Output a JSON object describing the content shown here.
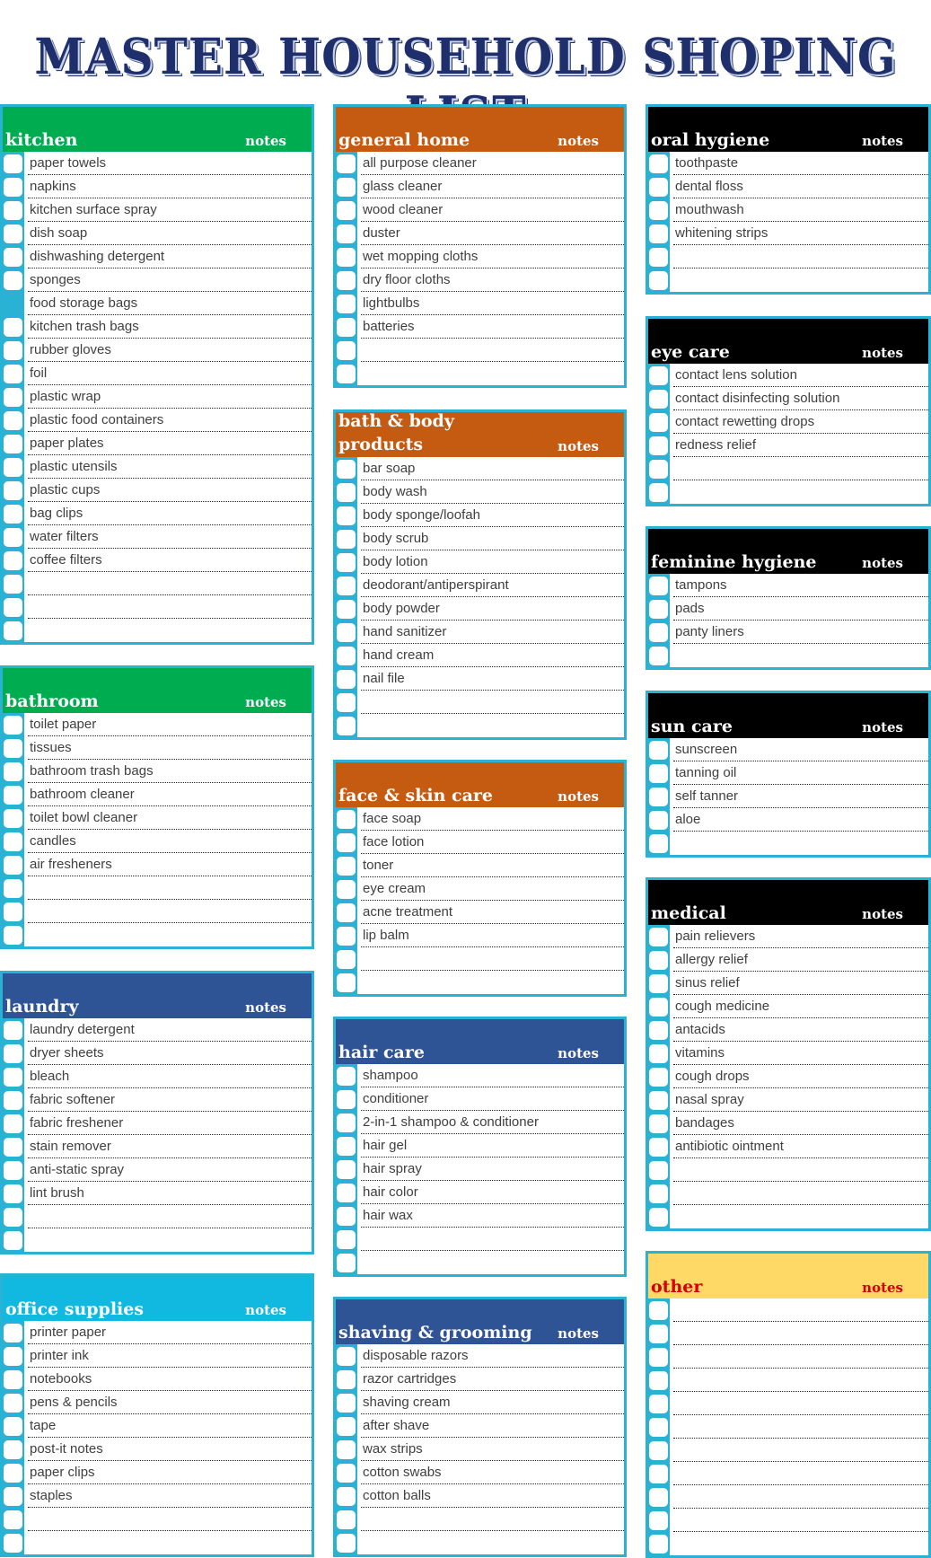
{
  "title": "MASTER HOUSEHOLD SHOPING LIST",
  "notes_label": "notes",
  "colors": {
    "border": "#29b2d3",
    "green": "#00ac50",
    "orange": "#c55a11",
    "navy": "#2f5496",
    "black": "#000000",
    "cyan": "#11b8e0",
    "yellow": "#ffd966",
    "red_text": "#d20000"
  },
  "sections": [
    {
      "id": "kitchen",
      "name": "kitchen",
      "color": "green",
      "items": [
        "paper towels",
        "napkins",
        "kitchen surface spray",
        "dish soap",
        "dishwashing detergent",
        "sponges",
        "food storage bags",
        "kitchen trash bags",
        "rubber gloves",
        "foil",
        "plastic wrap",
        "plastic food containers",
        "paper plates",
        "plastic utensils",
        "plastic cups",
        "bag clips",
        "water filters",
        "coffee filters",
        "",
        "",
        ""
      ],
      "filled_checkbox_index": 6
    },
    {
      "id": "bathroom",
      "name": "bathroom",
      "color": "green",
      "items": [
        "toilet paper",
        "tissues",
        "bathroom trash bags",
        "bathroom cleaner",
        "toilet bowl cleaner",
        "candles",
        "air fresheners",
        "",
        "",
        ""
      ]
    },
    {
      "id": "laundry",
      "name": "laundry",
      "color": "navy",
      "items": [
        "laundry detergent",
        "dryer sheets",
        "bleach",
        "fabric softener",
        "fabric freshener",
        "stain remover",
        "anti-static spray",
        "lint brush",
        "",
        ""
      ]
    },
    {
      "id": "office-supplies",
      "name": "office supplies",
      "color": "cyan",
      "items": [
        "printer paper",
        "printer ink",
        "notebooks",
        "pens & pencils",
        "tape",
        "post-it notes",
        "paper clips",
        "staples",
        "",
        ""
      ]
    },
    {
      "id": "general-home",
      "name": "general home",
      "color": "orange",
      "items": [
        "all purpose cleaner",
        "glass cleaner",
        "wood cleaner",
        "duster",
        "wet mopping cloths",
        "dry floor cloths",
        "lightbulbs",
        "batteries",
        "",
        ""
      ]
    },
    {
      "id": "bath-body",
      "name": "bath & body products",
      "name_line1": "bath & body",
      "name_line2": "products",
      "color": "orange",
      "items": [
        "bar soap",
        "body wash",
        "body sponge/loofah",
        "body scrub",
        "body lotion",
        "deodorant/antiperspirant",
        "body powder",
        "hand sanitizer",
        "hand cream",
        "nail file",
        "",
        ""
      ]
    },
    {
      "id": "face-skin",
      "name": "face & skin care",
      "color": "orange",
      "items": [
        "face soap",
        "face lotion",
        "toner",
        "eye cream",
        "acne treatment",
        "lip balm",
        "",
        ""
      ]
    },
    {
      "id": "hair-care",
      "name": "hair care",
      "color": "navy",
      "items": [
        "shampoo",
        "conditioner",
        "2-in-1 shampoo & conditioner",
        "hair gel",
        "hair spray",
        "hair color",
        "hair wax",
        "",
        ""
      ]
    },
    {
      "id": "shaving",
      "name": "shaving & grooming",
      "color": "navy",
      "items": [
        "disposable razors",
        "razor cartridges",
        "shaving cream",
        "after shave",
        "wax strips",
        "cotton swabs",
        "cotton balls",
        "",
        ""
      ]
    },
    {
      "id": "oral",
      "name": "oral hygiene",
      "color": "black",
      "items": [
        "toothpaste",
        "dental floss",
        "mouthwash",
        "whitening strips",
        "",
        ""
      ]
    },
    {
      "id": "eye",
      "name": "eye care",
      "color": "black",
      "items": [
        "contact lens solution",
        "contact disinfecting solution",
        "contact rewetting drops",
        "redness relief",
        "",
        ""
      ]
    },
    {
      "id": "feminine",
      "name": "feminine hygiene",
      "color": "black",
      "items": [
        "tampons",
        "pads",
        "panty liners",
        ""
      ]
    },
    {
      "id": "sun",
      "name": "sun care",
      "color": "black",
      "items": [
        "sunscreen",
        "tanning oil",
        "self tanner",
        "aloe",
        ""
      ]
    },
    {
      "id": "medical",
      "name": "medical",
      "color": "black",
      "items": [
        "pain relievers",
        "allergy relief",
        "sinus relief",
        "cough medicine",
        "antacids",
        "vitamins",
        "cough drops",
        "nasal spray",
        "bandages",
        "antibiotic ointment",
        "",
        "",
        ""
      ]
    },
    {
      "id": "other",
      "name": "other",
      "color": "yellow",
      "text_color": "red_text",
      "items": [
        "",
        "",
        "",
        "",
        "",
        "",
        "",
        "",
        "",
        "",
        ""
      ]
    }
  ]
}
